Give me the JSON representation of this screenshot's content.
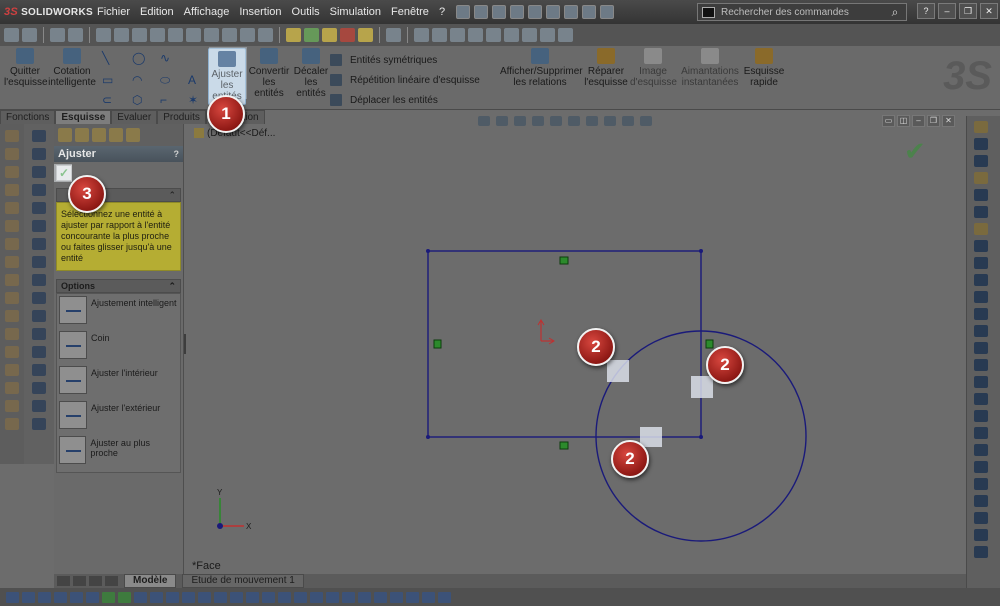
{
  "app": {
    "logo_text": "SOLIDWORKS",
    "logo_mark": "3S"
  },
  "menu": [
    "Fichier",
    "Edition",
    "Affichage",
    "Insertion",
    "Outils",
    "Simulation",
    "Fenêtre",
    "?"
  ],
  "search": {
    "placeholder": "Rechercher des commandes"
  },
  "ribbon": {
    "quit_sketch": "Quitter l'esquisse",
    "smart_dimension": "Cotation intelligente",
    "trim": "Ajuster les entités",
    "convert": "Convertir les entités",
    "offset": "Décaler les entités",
    "mirror": "Entités symétriques",
    "linear_pattern": "Répétition linéaire d'esquisse",
    "move": "Déplacer les entités",
    "show_relations": "Afficher/Supprimer les relations",
    "repair": "Réparer l'esquisse",
    "sketch_picture": "Image d'esquisse",
    "instant_snaps": "Aimantations instantanées",
    "rapid_sketch": "Esquisse rapide"
  },
  "tabs": [
    "Fonctions",
    "Esquisse",
    "Evaluer",
    "Produits",
    "Simulation"
  ],
  "active_tab": "Esquisse",
  "property_manager": {
    "title": "Ajuster",
    "help": "?",
    "message": "Sélectionnez une entité à ajuster par rapport à l'entité concourante la plus proche ou faites glisser jusqu'à une entité",
    "options_title": "Options",
    "options": [
      "Ajustement intelligent",
      "Coin",
      "Ajuster l'intérieur",
      "Ajuster l'extérieur",
      "Ajuster au plus proche"
    ]
  },
  "viewport": {
    "breadcrumb": "(Défaut<<Déf...",
    "view_label": "*Face"
  },
  "bottom_tabs": [
    "Modèle",
    "Etude de mouvement 1"
  ],
  "callouts": [
    "1",
    "2",
    "2",
    "2",
    "3"
  ],
  "colors": {
    "sketch_line": "#1a1a7a",
    "callout_red": "#b52a22",
    "message_bg": "#b5ad33"
  }
}
